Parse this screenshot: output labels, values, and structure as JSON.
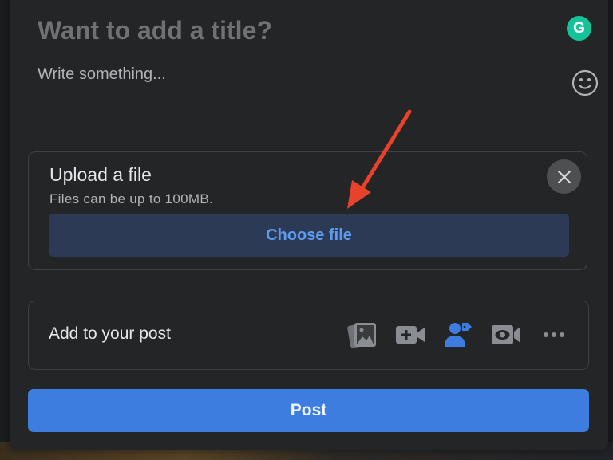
{
  "composer": {
    "title_placeholder": "Want to add a title?",
    "body_placeholder": "Write something..."
  },
  "upload": {
    "title": "Upload a file",
    "subtitle": "Files can be up to 100MB.",
    "choose_label": "Choose file",
    "close_icon": "close-icon"
  },
  "add_to_post": {
    "label": "Add to your post",
    "icons": [
      "photo-icon",
      "video-add-icon",
      "tag-people-icon",
      "live-video-icon",
      "more-icon"
    ]
  },
  "post_button": "Post",
  "grammarly_letter": "G",
  "colors": {
    "dialog_bg": "#242526",
    "accent": "#3e7de0",
    "choose_bg": "#2d3a55",
    "choose_text": "#5b9bf0",
    "arrow": "#e8412c",
    "grammarly": "#15c39a"
  }
}
